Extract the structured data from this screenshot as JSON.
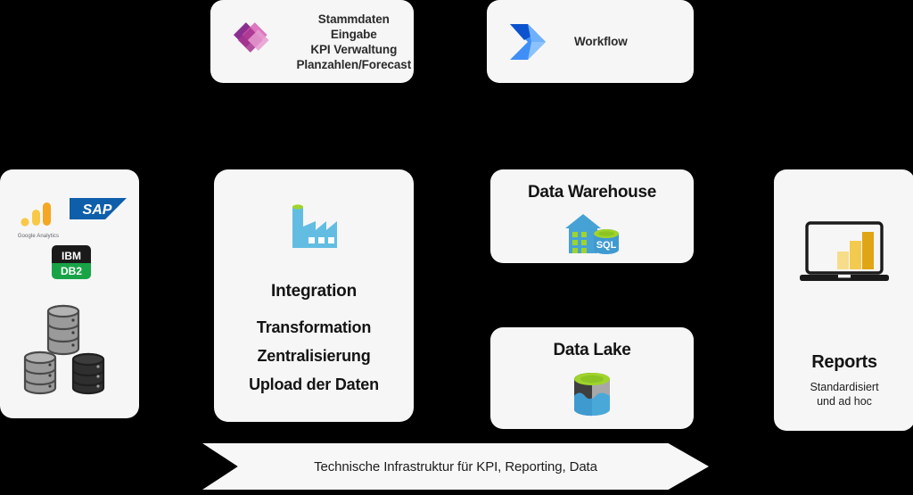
{
  "diagram": {
    "background_color": "#000000",
    "card_color": "#f6f6f7"
  },
  "top_row": {
    "cards": [
      {
        "id": "stammdaten",
        "icon": "power-apps-icon",
        "lines": [
          "Stammdaten Eingabe",
          "KPI Verwaltung",
          "Planzahlen/Forecast"
        ]
      },
      {
        "id": "workflow",
        "icon": "power-automate-icon",
        "label": "Workflow"
      }
    ]
  },
  "sources": {
    "logos": [
      {
        "name": "google-analytics-logo",
        "caption": "Google Analytics"
      },
      {
        "name": "sap-logo",
        "text": "SAP"
      },
      {
        "name": "ibm-db2-logo",
        "top_text": "IBM",
        "bottom_text": "DB2"
      }
    ],
    "servers_icon": "database-servers-icon"
  },
  "integration": {
    "icon": "factory-icon",
    "title": "Integration",
    "lines": [
      "Transformation",
      "Zentralisierung",
      "Upload der Daten"
    ]
  },
  "stores": [
    {
      "id": "data-warehouse",
      "title": "Data Warehouse",
      "icon": "warehouse-sql-icon",
      "sql_label": "SQL"
    },
    {
      "id": "data-lake",
      "title": "Data Lake",
      "icon": "data-lake-cylinder-icon"
    }
  ],
  "reports": {
    "icon": "laptop-powerbi-icon",
    "title": "Reports",
    "subtitle_line1": "Standardisiert",
    "subtitle_line2": "und ad hoc"
  },
  "banner": {
    "text": "Technische Infrastruktur für KPI, Reporting, Data",
    "shape": "chevron-arrow-right"
  },
  "colors": {
    "power_apps_dark": "#8a2f8f",
    "power_apps_light": "#d86cbb",
    "power_automate_dark": "#0b53ce",
    "power_automate_light": "#3f8ff7",
    "factory_blue": "#63bde2",
    "factory_green": "#9fd42c",
    "sap_blue": "#0f5eaa",
    "db2_green": "#19a347",
    "powerbi_amber": "#e8a712"
  }
}
